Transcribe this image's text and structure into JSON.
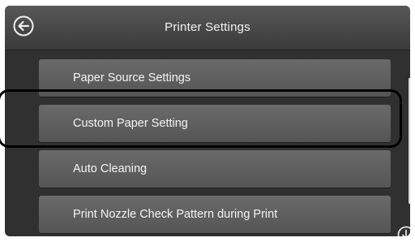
{
  "header": {
    "title": "Printer Settings",
    "back_icon": "back-arrow-icon"
  },
  "menu": {
    "items": [
      {
        "label": "Paper Source Settings"
      },
      {
        "label": "Custom Paper Setting"
      },
      {
        "label": "Auto Cleaning"
      },
      {
        "label": "Print Nozzle Check Pattern during Print"
      }
    ],
    "selected_index": 1
  },
  "scroll": {
    "down_icon": "scroll-down-arrow-icon"
  },
  "colors": {
    "screen_bg": "#303030",
    "item_bg": "#5e5e5e",
    "text": "#f4f4f4",
    "highlight_border": "#000000"
  }
}
